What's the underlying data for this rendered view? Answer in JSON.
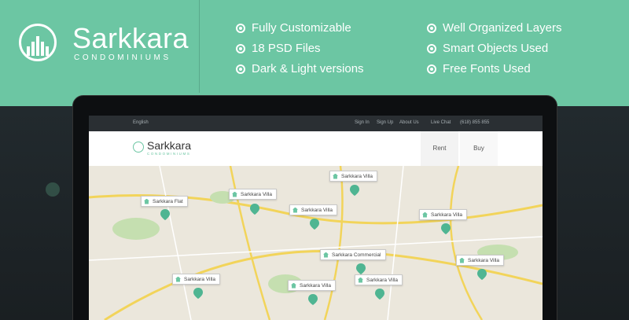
{
  "brand": {
    "name": "Sarkkara",
    "subtitle": "CONDOMINIUMS"
  },
  "features": {
    "col1": [
      "Fully Customizable",
      "18 PSD Files",
      "Dark & Light versions"
    ],
    "col2": [
      "Well Organized Layers",
      "Smart Objects Used",
      "Free Fonts Used"
    ]
  },
  "site": {
    "topbar": {
      "language": "English",
      "signin": "Sign In",
      "signup": "Sign Up",
      "about": "About Us",
      "chat": "Live Chat",
      "phone": "(618) 855 855"
    },
    "brand": {
      "name": "Sarkkara",
      "subtitle": "CONDOMINIUMS"
    },
    "tabs": {
      "rent": "Rent",
      "buy": "Buy"
    },
    "markers": [
      "Sarkkara Flat",
      "Sarkkara Villa",
      "Sarkkara Villa",
      "Sarkkara Villa",
      "Sarkkara Villa",
      "Sarkkara Commercial",
      "Sarkkara Villa",
      "Sarkkara Villa",
      "Sarkkara Villa",
      "Sarkkara Villa"
    ]
  },
  "colors": {
    "accent": "#6cc6a3",
    "dark": "#1e2427"
  }
}
